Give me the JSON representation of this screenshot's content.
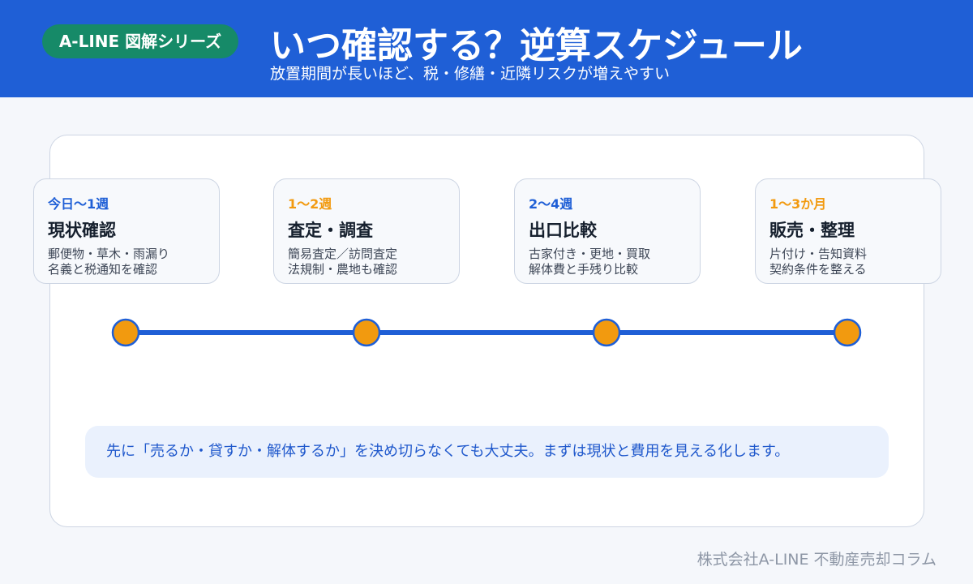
{
  "header": {
    "badge": "A-LINE 図解シリーズ",
    "title": "いつ確認する？逆算スケジュール",
    "subtitle": "放置期間が長いほど、税・修繕・近隣リスクが増えやすい"
  },
  "stages": [
    {
      "period": "今日〜1週",
      "period_color": "#1f5fd6",
      "title": "現状確認",
      "desc": [
        "郵便物・草木・雨漏り",
        "名義と税通知を確認"
      ]
    },
    {
      "period": "1〜2週",
      "period_color": "#f29a0f",
      "title": "査定・調査",
      "desc": [
        "簡易査定／訪問査定",
        "法規制・農地も確認"
      ]
    },
    {
      "period": "2〜4週",
      "period_color": "#1f5fd6",
      "title": "出口比較",
      "desc": [
        "古家付き・更地・買取",
        "解体費と手残り比較"
      ]
    },
    {
      "period": "1〜3か月",
      "period_color": "#f29a0f",
      "title": "販売・整理",
      "desc": [
        "片付け・告知資料",
        "契約条件を整える"
      ]
    }
  ],
  "colors": {
    "header_bg": "#1f5fd6",
    "badge_bg": "#168a68",
    "timeline_line": "#1f5fd6",
    "node_fill": "#f29a0f",
    "node_stroke": "#1f5fd6"
  },
  "note": "先に「売るか・貸すか・解体するか」を決め切らなくても大丈夫。まずは現状と費用を見える化します。",
  "footer": "株式会社A-LINE 不動産売却コラム"
}
